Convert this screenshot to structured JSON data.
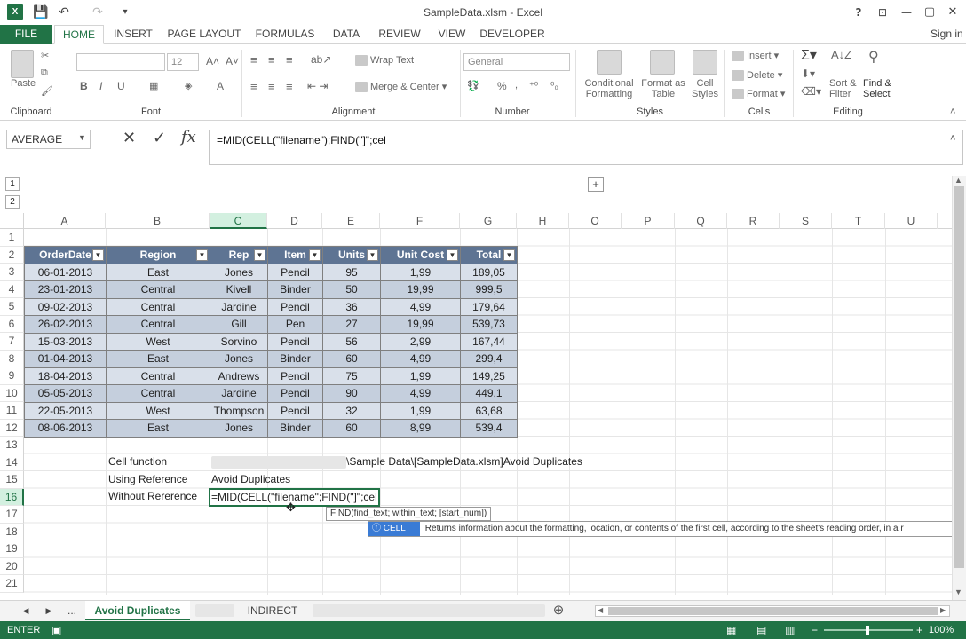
{
  "window": {
    "title": "SampleData.xlsm - Excel",
    "help": "?",
    "ribbon_display": "⊡",
    "minimize": "—",
    "maximize": "▢",
    "close": "✕",
    "signin": "Sign in"
  },
  "qat": {
    "save": "💾",
    "undo": "↶",
    "redo": "↷",
    "customize": "▾"
  },
  "ribbon_tabs": [
    "FILE",
    "HOME",
    "INSERT",
    "PAGE LAYOUT",
    "FORMULAS",
    "DATA",
    "REVIEW",
    "VIEW",
    "DEVELOPER"
  ],
  "ribbon": {
    "clipboard": {
      "label": "Clipboard",
      "paste": "Paste"
    },
    "font": {
      "label": "Font",
      "size": "12",
      "bold": "B",
      "italic": "I",
      "underline": "U"
    },
    "alignment": {
      "label": "Alignment",
      "wrap_text": "Wrap Text",
      "merge_center": "Merge & Center"
    },
    "number": {
      "label": "Number",
      "format": "General",
      "percent": "%"
    },
    "styles": {
      "label": "Styles",
      "conditional_1": "Conditional",
      "conditional_2": "Formatting",
      "format_table_1": "Format as",
      "format_table_2": "Table",
      "cell_styles_1": "Cell",
      "cell_styles_2": "Styles"
    },
    "cells": {
      "label": "Cells",
      "insert": "Insert",
      "delete": "Delete",
      "format": "Format"
    },
    "editing": {
      "label": "Editing",
      "sort_1": "Sort &",
      "sort_2": "Filter",
      "find_1": "Find &",
      "find_2": "Select"
    }
  },
  "formula_bar": {
    "name_box": "AVERAGE",
    "cancel": "✕",
    "enter": "✓",
    "fx": "fx",
    "formula": "=MID(CELL(\"filename\");FIND(\"]\";cel"
  },
  "outline": {
    "level1": "1",
    "level2": "2",
    "expand": "+"
  },
  "columns": [
    "A",
    "B",
    "C",
    "D",
    "E",
    "F",
    "G",
    "H",
    "O",
    "P",
    "Q",
    "R",
    "S",
    "T",
    "U"
  ],
  "rows": [
    "1",
    "2",
    "3",
    "4",
    "5",
    "6",
    "7",
    "8",
    "9",
    "10",
    "11",
    "12",
    "13",
    "14",
    "15",
    "16",
    "17",
    "18",
    "19",
    "20",
    "21"
  ],
  "table": {
    "headers": [
      "OrderDate",
      "Region",
      "Rep",
      "Item",
      "Units",
      "Unit Cost",
      "Total"
    ],
    "rows": [
      [
        "06-01-2013",
        "East",
        "Jones",
        "Pencil",
        "95",
        "1,99",
        "189,05"
      ],
      [
        "23-01-2013",
        "Central",
        "Kivell",
        "Binder",
        "50",
        "19,99",
        "999,5"
      ],
      [
        "09-02-2013",
        "Central",
        "Jardine",
        "Pencil",
        "36",
        "4,99",
        "179,64"
      ],
      [
        "26-02-2013",
        "Central",
        "Gill",
        "Pen",
        "27",
        "19,99",
        "539,73"
      ],
      [
        "15-03-2013",
        "West",
        "Sorvino",
        "Pencil",
        "56",
        "2,99",
        "167,44"
      ],
      [
        "01-04-2013",
        "East",
        "Jones",
        "Binder",
        "60",
        "4,99",
        "299,4"
      ],
      [
        "18-04-2013",
        "Central",
        "Andrews",
        "Pencil",
        "75",
        "1,99",
        "149,25"
      ],
      [
        "05-05-2013",
        "Central",
        "Jardine",
        "Pencil",
        "90",
        "4,99",
        "449,1"
      ],
      [
        "22-05-2013",
        "West",
        "Thompson",
        "Pencil",
        "32",
        "1,99",
        "63,68"
      ],
      [
        "08-06-2013",
        "East",
        "Jones",
        "Binder",
        "60",
        "8,99",
        "539,4"
      ]
    ]
  },
  "notes": {
    "cell_function": "Cell function",
    "cell_function_value": "\\Sample Data\\[SampleData.xlsm]Avoid Duplicates",
    "using_reference": "Using Reference",
    "using_reference_value": "Avoid Duplicates",
    "without_reference": "Without Rererence",
    "editing_formula": "=MID(CELL(\"filename\";FIND(\"]\";cel"
  },
  "tooltips": {
    "find_syntax": "FIND(find_text; within_text; [start_num])",
    "ac_item": "CELL",
    "ac_desc": "Returns information about the formatting, location, or contents of the first cell, according to the sheet's reading order, in a r"
  },
  "sheets": {
    "more": "...",
    "active": "Avoid Duplicates",
    "other": "INDIRECT",
    "add": "⊕"
  },
  "status": {
    "mode": "ENTER",
    "zoom": "100%"
  },
  "colors": {
    "excel_green": "#217346",
    "table_header": "#5e7493",
    "row_odd": "#d9e0ea",
    "row_even": "#c5cfdd"
  }
}
